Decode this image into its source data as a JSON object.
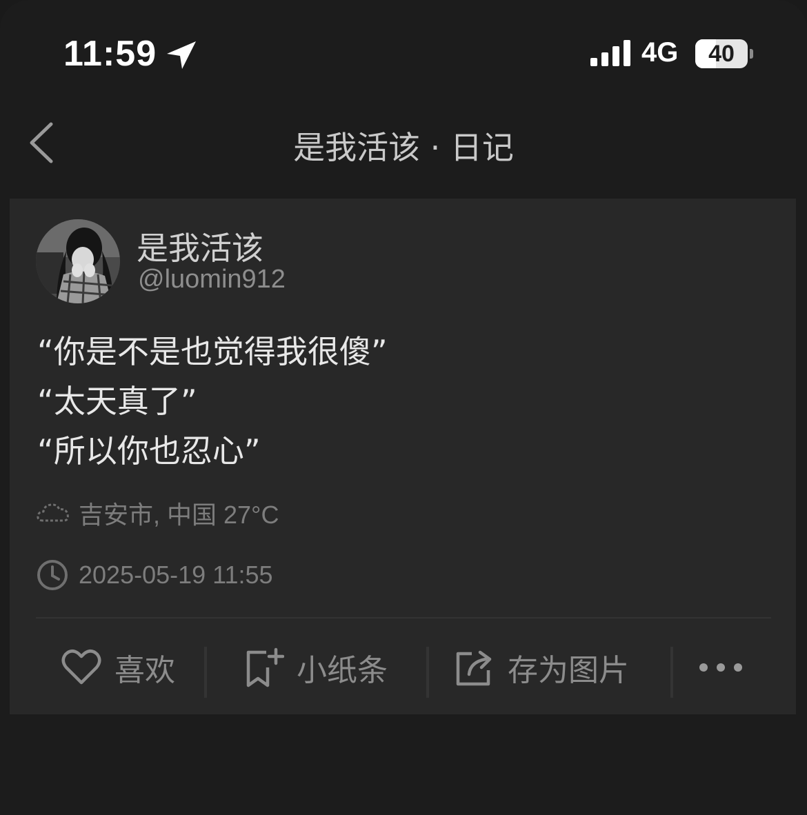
{
  "status_bar": {
    "time": "11:59",
    "network": "4G",
    "battery_level": "40",
    "battery_fraction": 0.4
  },
  "nav": {
    "title": "是我活该 · 日记"
  },
  "post": {
    "author_name": "是我活该",
    "author_handle": "@luomin912",
    "lines": [
      "“你是不是也觉得我很傻”",
      "“太天真了”",
      "“所以你也忍心”"
    ],
    "location": "吉安市, 中国 27°C",
    "timestamp": "2025-05-19 11:55"
  },
  "actions": {
    "like": "喜欢",
    "note": "小纸条",
    "save_image": "存为图片"
  },
  "icons": {
    "location": "location-arrow-icon",
    "signal": "cellular-signal-icon",
    "back": "chevron-left-icon",
    "weather": "cloud-icon",
    "clock": "clock-icon",
    "like": "heart-icon",
    "note": "add-note-icon",
    "share": "share-export-icon",
    "more": "more-dots-icon"
  },
  "colors": {
    "background": "#1c1c1c",
    "card": "#282828",
    "text_primary": "#e8e8e8",
    "text_secondary": "#8c8c8c"
  }
}
